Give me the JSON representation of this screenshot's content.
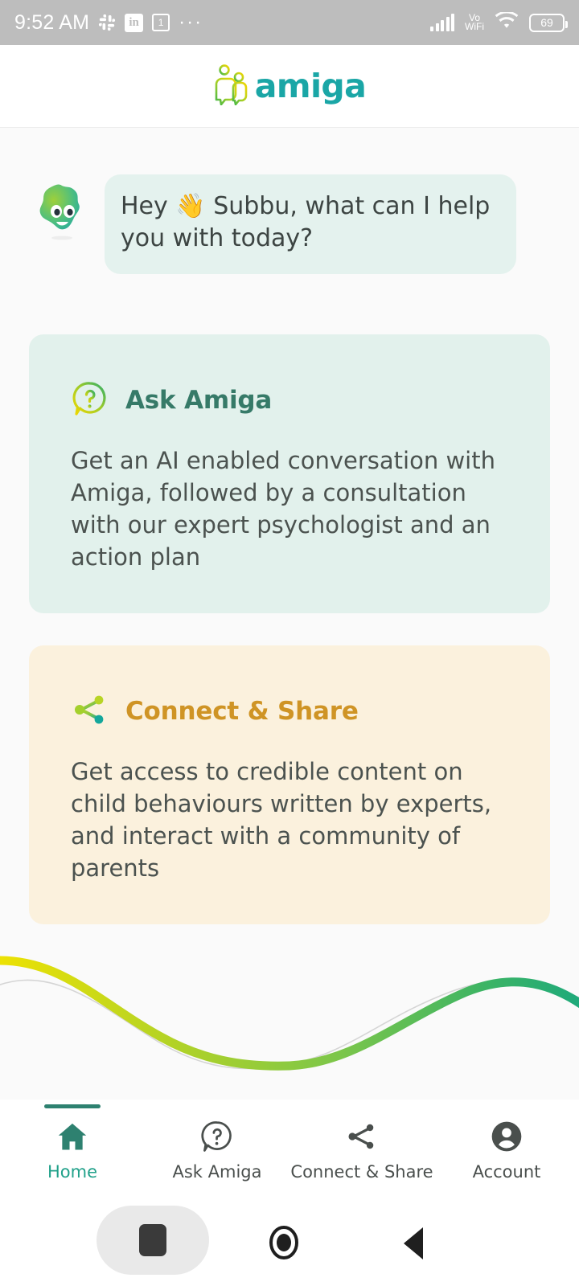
{
  "statusbar": {
    "time": "9:52 AM",
    "icons": [
      "slack-icon",
      "linkedin-icon",
      "calendar-icon",
      "overflow-dots-icon"
    ],
    "calendar_day": "1",
    "network": "Vo WiFi",
    "volte_line1": "Vo",
    "volte_line2": "WiFi",
    "battery_percent": "69",
    "bg_color": "#bdbdbd"
  },
  "header": {
    "brand_name": "amiga",
    "brand_color": "#1aa6a6",
    "logo_icon": "amiga-logo-icon"
  },
  "greeting": {
    "avatar_icon": "amiga-mascot-avatar",
    "message": "Hey 👋 Subbu, what can I help you with today?",
    "bubble_color": "#e4f2ee"
  },
  "cards": [
    {
      "id": "ask-amiga",
      "icon": "question-chat-bubble-icon",
      "title": "Ask Amiga",
      "title_color": "#367a68",
      "body": "Get an AI enabled conversation with Amiga, followed by a consultation with our expert psychologist and an action plan",
      "bg_color": "#e2f1ec"
    },
    {
      "id": "connect-share",
      "icon": "share-nodes-icon",
      "title": "Connect & Share",
      "title_color": "#cf9425",
      "body": "Get access to credible content on child behaviours written by experts, and interact with a community of parents",
      "bg_color": "#fbf1dd"
    }
  ],
  "decoration": {
    "wave_colors": [
      "#f2e300",
      "#8dc63f",
      "#2eb872",
      "#1aa87e"
    ],
    "wave_secondary_color": "#d5d5d5"
  },
  "bottom_nav": {
    "active_index": 0,
    "active_color": "#21a18a",
    "indicator_color": "#2e8170",
    "items": [
      {
        "label": "Home",
        "icon": "home-icon"
      },
      {
        "label": "Ask Amiga",
        "icon": "question-chat-bubble-icon"
      },
      {
        "label": "Connect & Share",
        "icon": "share-nodes-icon"
      },
      {
        "label": "Account",
        "icon": "account-person-icon"
      }
    ]
  },
  "android_nav": {
    "recents": "recents-square-icon",
    "home": "home-circle-icon",
    "back": "back-triangle-icon"
  }
}
